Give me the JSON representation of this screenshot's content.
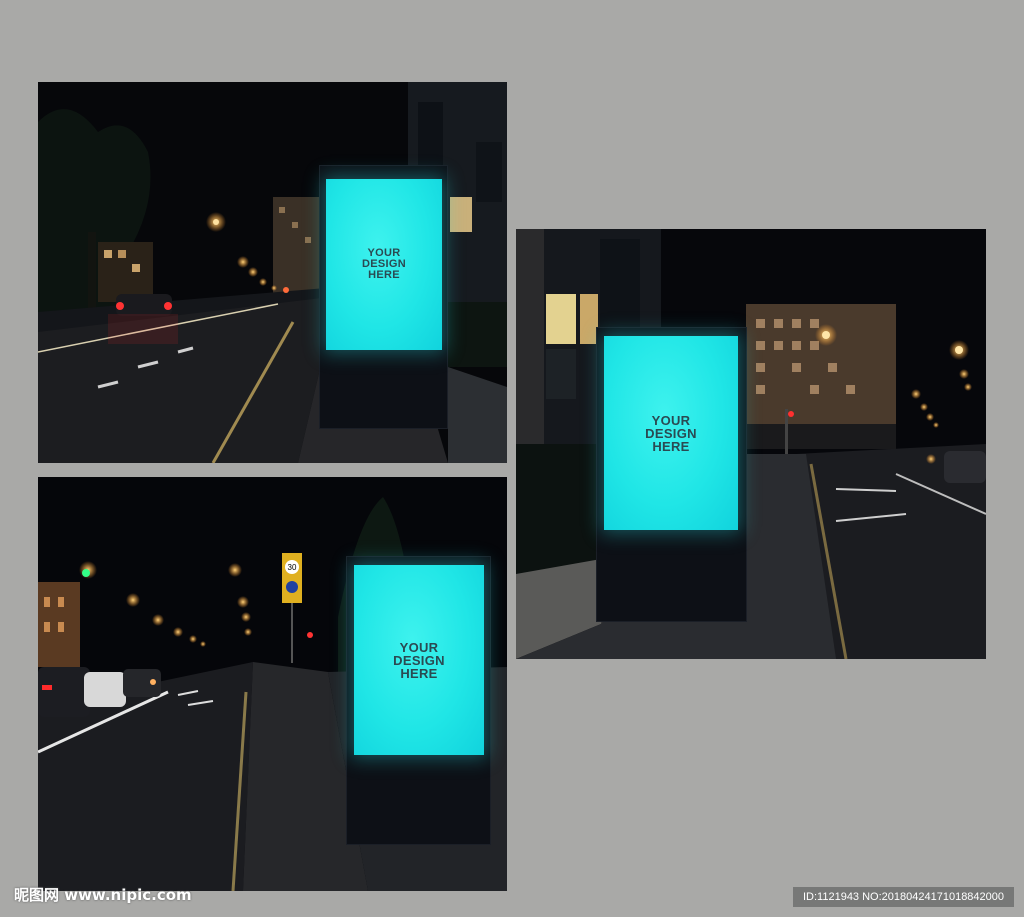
{
  "billboard_text": "YOUR\nDESIGN\nHERE",
  "sign_number": "30",
  "watermark": {
    "site": "昵图网 www.nipic.com",
    "id_line": "ID:1121943 NO:20180424171018842000"
  },
  "colors": {
    "background": "#a9a9a7",
    "screen": "#20e6e6",
    "night_sky": "#07080b",
    "street_light": "#ffb347"
  }
}
